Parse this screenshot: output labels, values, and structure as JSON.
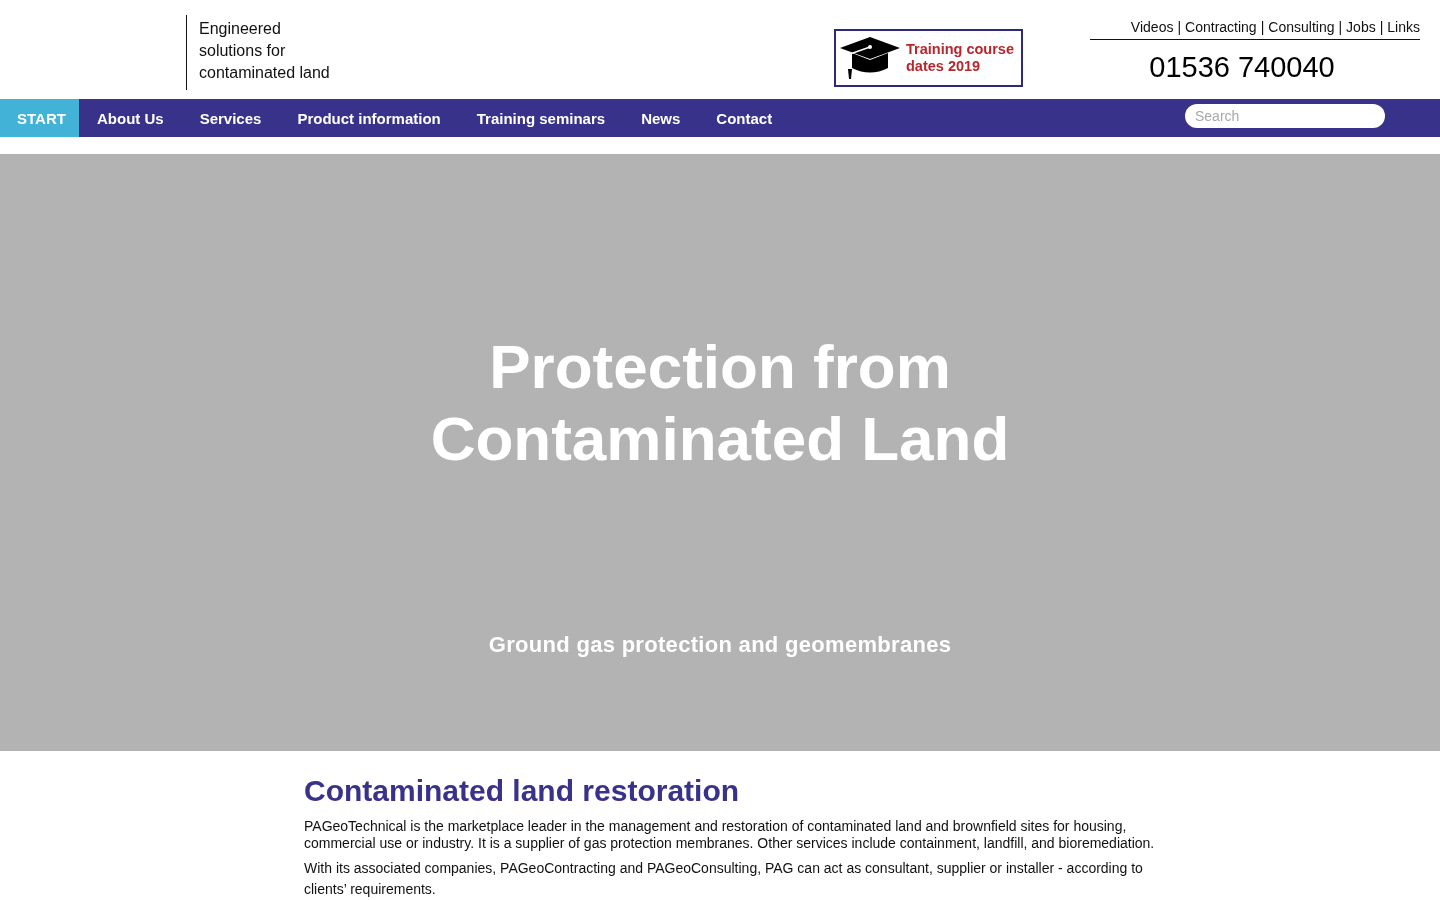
{
  "header": {
    "tagline": "Engineered solutions for contaminated land",
    "training_banner": {
      "text": "Training course dates 2019"
    },
    "top_links": {
      "items": [
        "Videos",
        "Contracting",
        "Consulting",
        "Jobs",
        "Links"
      ],
      "separator": "|"
    },
    "phone": "01536 740040"
  },
  "nav": {
    "items": [
      {
        "label": "START",
        "selected": true
      },
      {
        "label": "About Us",
        "selected": false
      },
      {
        "label": "Services",
        "selected": false
      },
      {
        "label": "Product information",
        "selected": false
      },
      {
        "label": "Training seminars",
        "selected": false
      },
      {
        "label": "News",
        "selected": false
      },
      {
        "label": "Contact",
        "selected": false
      }
    ],
    "search": {
      "placeholder": "Search"
    }
  },
  "hero": {
    "title": "Protection from Contaminated Land",
    "subtitle": "Ground gas protection and geomembranes"
  },
  "content": {
    "heading": "Contaminated land restoration",
    "paragraphs": [
      "PAGeoTechnical is the marketplace leader in the management and restoration of contaminated land and brownfield sites for housing, commercial use or industry. It is a supplier of gas protection membranes. Other services include containment, landfill, and bioremediation.",
      "With its associated companies, PAGeoContracting and PAGeoConsulting, PAG can act as consultant, supplier or installer - according to clients’ requirements."
    ]
  }
}
